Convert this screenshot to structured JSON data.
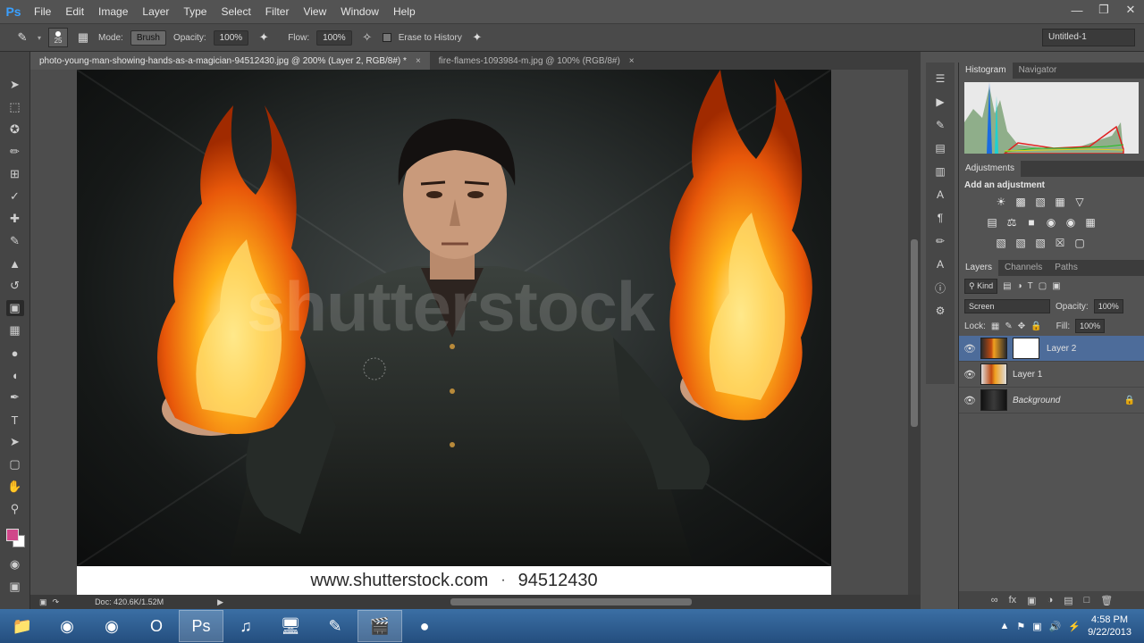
{
  "app": {
    "logo": "Ps"
  },
  "menu": [
    "File",
    "Edit",
    "Image",
    "Layer",
    "Type",
    "Select",
    "Filter",
    "View",
    "Window",
    "Help"
  ],
  "window_controls": [
    "minimize-icon",
    "restore-icon",
    "close-icon"
  ],
  "options": {
    "brush_size": "25",
    "mode_label": "Mode:",
    "mode_value": "Brush",
    "opacity_label": "Opacity:",
    "opacity_value": "100%",
    "flow_label": "Flow:",
    "flow_value": "100%",
    "erase_label": "Erase to History",
    "workspace": "Untitled-1"
  },
  "tabs": [
    {
      "label": "photo-young-man-showing-hands-as-a-magician-94512430.jpg @ 200% (Layer 2, RGB/8#) *",
      "close": "×"
    },
    {
      "label": "fire-flames-1093984-m.jpg @ 100% (RGB/8#)",
      "close": "×"
    }
  ],
  "canvas": {
    "watermark": "shutterstock",
    "footer_site": "www.shutterstock.com",
    "footer_dot": "·",
    "footer_id": "94512430"
  },
  "status": {
    "doc": "Doc: 420.6K/1.52M"
  },
  "panels": {
    "top_tabs": [
      "Histogram",
      "Navigator"
    ],
    "adjustments_tab": "Adjustments",
    "adjustments_title": "Add an adjustment",
    "layers_tabs": [
      "Layers",
      "Channels",
      "Paths"
    ],
    "kind_label": "Kind",
    "blend_mode": "Screen",
    "opacity_label": "Opacity:",
    "opacity_value": "100%",
    "lock_label": "Lock:",
    "fill_label": "Fill:",
    "fill_value": "100%",
    "layers": [
      {
        "name": "Layer 2",
        "selected": true
      },
      {
        "name": "Layer 1",
        "selected": false
      },
      {
        "name": "Background",
        "selected": false
      }
    ]
  },
  "taskbar": {
    "time": "4:58 PM",
    "date": "9/22/2013"
  },
  "colors": {
    "foreground_swatch": "#d0478a",
    "selection": "#4d6c9a",
    "taskbar": "#2f5f93"
  }
}
